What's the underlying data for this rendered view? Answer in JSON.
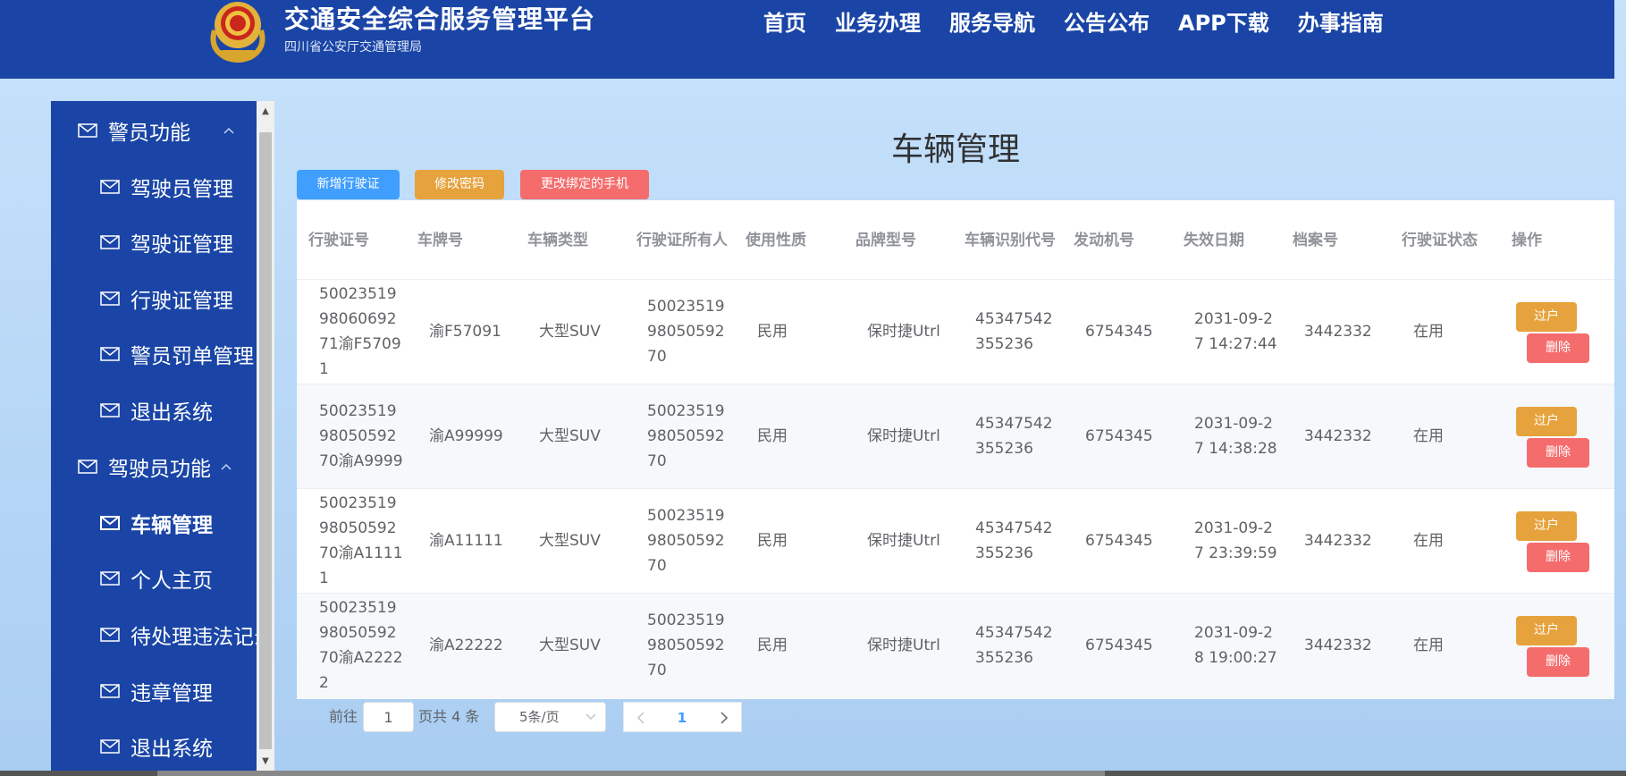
{
  "header": {
    "title": "交通安全综合服务管理平台",
    "subtitle": "四川省公安厅交通管理局",
    "nav": [
      "首页",
      "业务办理",
      "服务导航",
      "公告公布",
      "APP下载",
      "办事指南"
    ]
  },
  "sidebar": {
    "groups": [
      {
        "label": "警员功能",
        "items": [
          "驾驶员管理",
          "驾驶证管理",
          "行驶证管理",
          "警员罚单管理",
          "退出系统"
        ]
      },
      {
        "label": "驾驶员功能",
        "items": [
          "车辆管理",
          "个人主页",
          "待处理违法记录",
          "违章管理",
          "退出系统"
        ]
      }
    ],
    "active_item": "车辆管理"
  },
  "page": {
    "title": "车辆管理",
    "buttons": {
      "add": "新增行驶证",
      "change_password": "修改密码",
      "change_phone": "更改绑定的手机"
    }
  },
  "table": {
    "headers": [
      "行驶证号",
      "车牌号",
      "车辆类型",
      "行驶证所有人",
      "使用性质",
      "品牌型号",
      "车辆识别代号",
      "发动机号",
      "失效日期",
      "档案号",
      "行驶证状态",
      "操作"
    ],
    "rows": [
      [
        "500235199806069271渝F57091",
        "渝F57091",
        "大型SUV",
        "500235199805059270",
        "民用",
        "保时捷Utrl",
        "45347542355236",
        "6754345",
        "2031-09-27 14:27:44",
        "3442332",
        "在用"
      ],
      [
        "500235199805059270渝A9999",
        "渝A99999",
        "大型SUV",
        "500235199805059270",
        "民用",
        "保时捷Utrl",
        "45347542355236",
        "6754345",
        "2031-09-27 14:38:28",
        "3442332",
        "在用"
      ],
      [
        "500235199805059270渝A11111",
        "渝A11111",
        "大型SUV",
        "500235199805059270",
        "民用",
        "保时捷Utrl",
        "45347542355236",
        "6754345",
        "2031-09-27 23:39:59",
        "3442332",
        "在用"
      ],
      [
        "500235199805059270渝A22222",
        "渝A22222",
        "大型SUV",
        "500235199805059270",
        "民用",
        "保时捷Utrl",
        "45347542355236",
        "6754345",
        "2031-09-28 19:00:27",
        "3442332",
        "在用"
      ]
    ],
    "actions": {
      "transfer": "过户",
      "delete": "删除"
    }
  },
  "pagination": {
    "goto_prefix": "前往",
    "goto_value": "1",
    "goto_suffix": "页共 4 条",
    "page_size": "5条/页",
    "current_page": "1"
  },
  "colors": {
    "header_bg": "#1a45a6",
    "primary": "#409eff",
    "warning": "#e6a23c",
    "danger": "#f56c6c"
  }
}
